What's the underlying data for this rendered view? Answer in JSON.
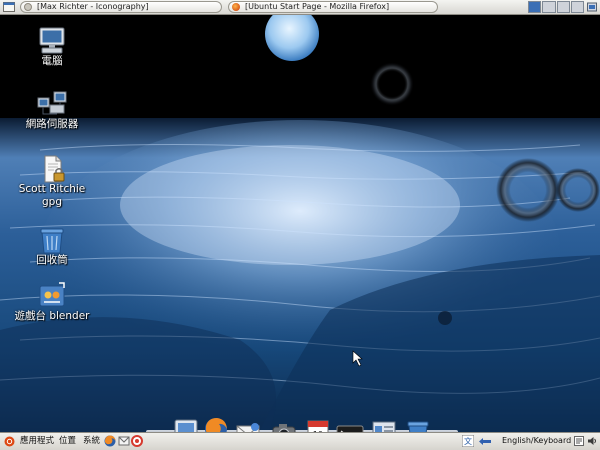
{
  "top_panel": {
    "tasks": [
      {
        "title": "[Max Richter - Iconography]",
        "icon": "terminal-window-icon"
      },
      {
        "title": "[Ubuntu Start Page - Mozilla Firefox]",
        "icon": "firefox-icon"
      }
    ],
    "workspace_count": 4,
    "active_workspace": 0
  },
  "desktop_icons": [
    {
      "label": "電腦",
      "icon": "computer-icon"
    },
    {
      "label": "網路伺服器",
      "icon": "network-servers-icon"
    },
    {
      "label": "Scott Ritchie gpg",
      "icon": "gpg-key-file-icon"
    },
    {
      "label": "回收筒",
      "icon": "trash-icon"
    },
    {
      "label": "遊戲台 blender",
      "icon": "blender-shortcut-icon"
    }
  ],
  "bottom_panel": {
    "menus": [
      "應用程式",
      "位置",
      "系統"
    ],
    "launchers": [
      "firefox-icon",
      "mail-icon",
      "help-icon"
    ],
    "keyboard_label": "English/Keyboard",
    "tray_icons": [
      "input-method-icon",
      "keyboard-layout-icon",
      "volume-icon"
    ]
  },
  "dock": {
    "items": [
      "home-folder-icon",
      "firefox-icon",
      "mail-icon",
      "camera-icon",
      "calendar-icon",
      "terminal-icon",
      "file-manager-icon",
      "trash-icon"
    ],
    "calendar_day": "19",
    "calendar_month": "OCT"
  },
  "colors": {
    "panel": "#e2e1dc",
    "active_workspace": "#3b6fb5",
    "sea": "#1b4f86",
    "sky": "#000000"
  }
}
